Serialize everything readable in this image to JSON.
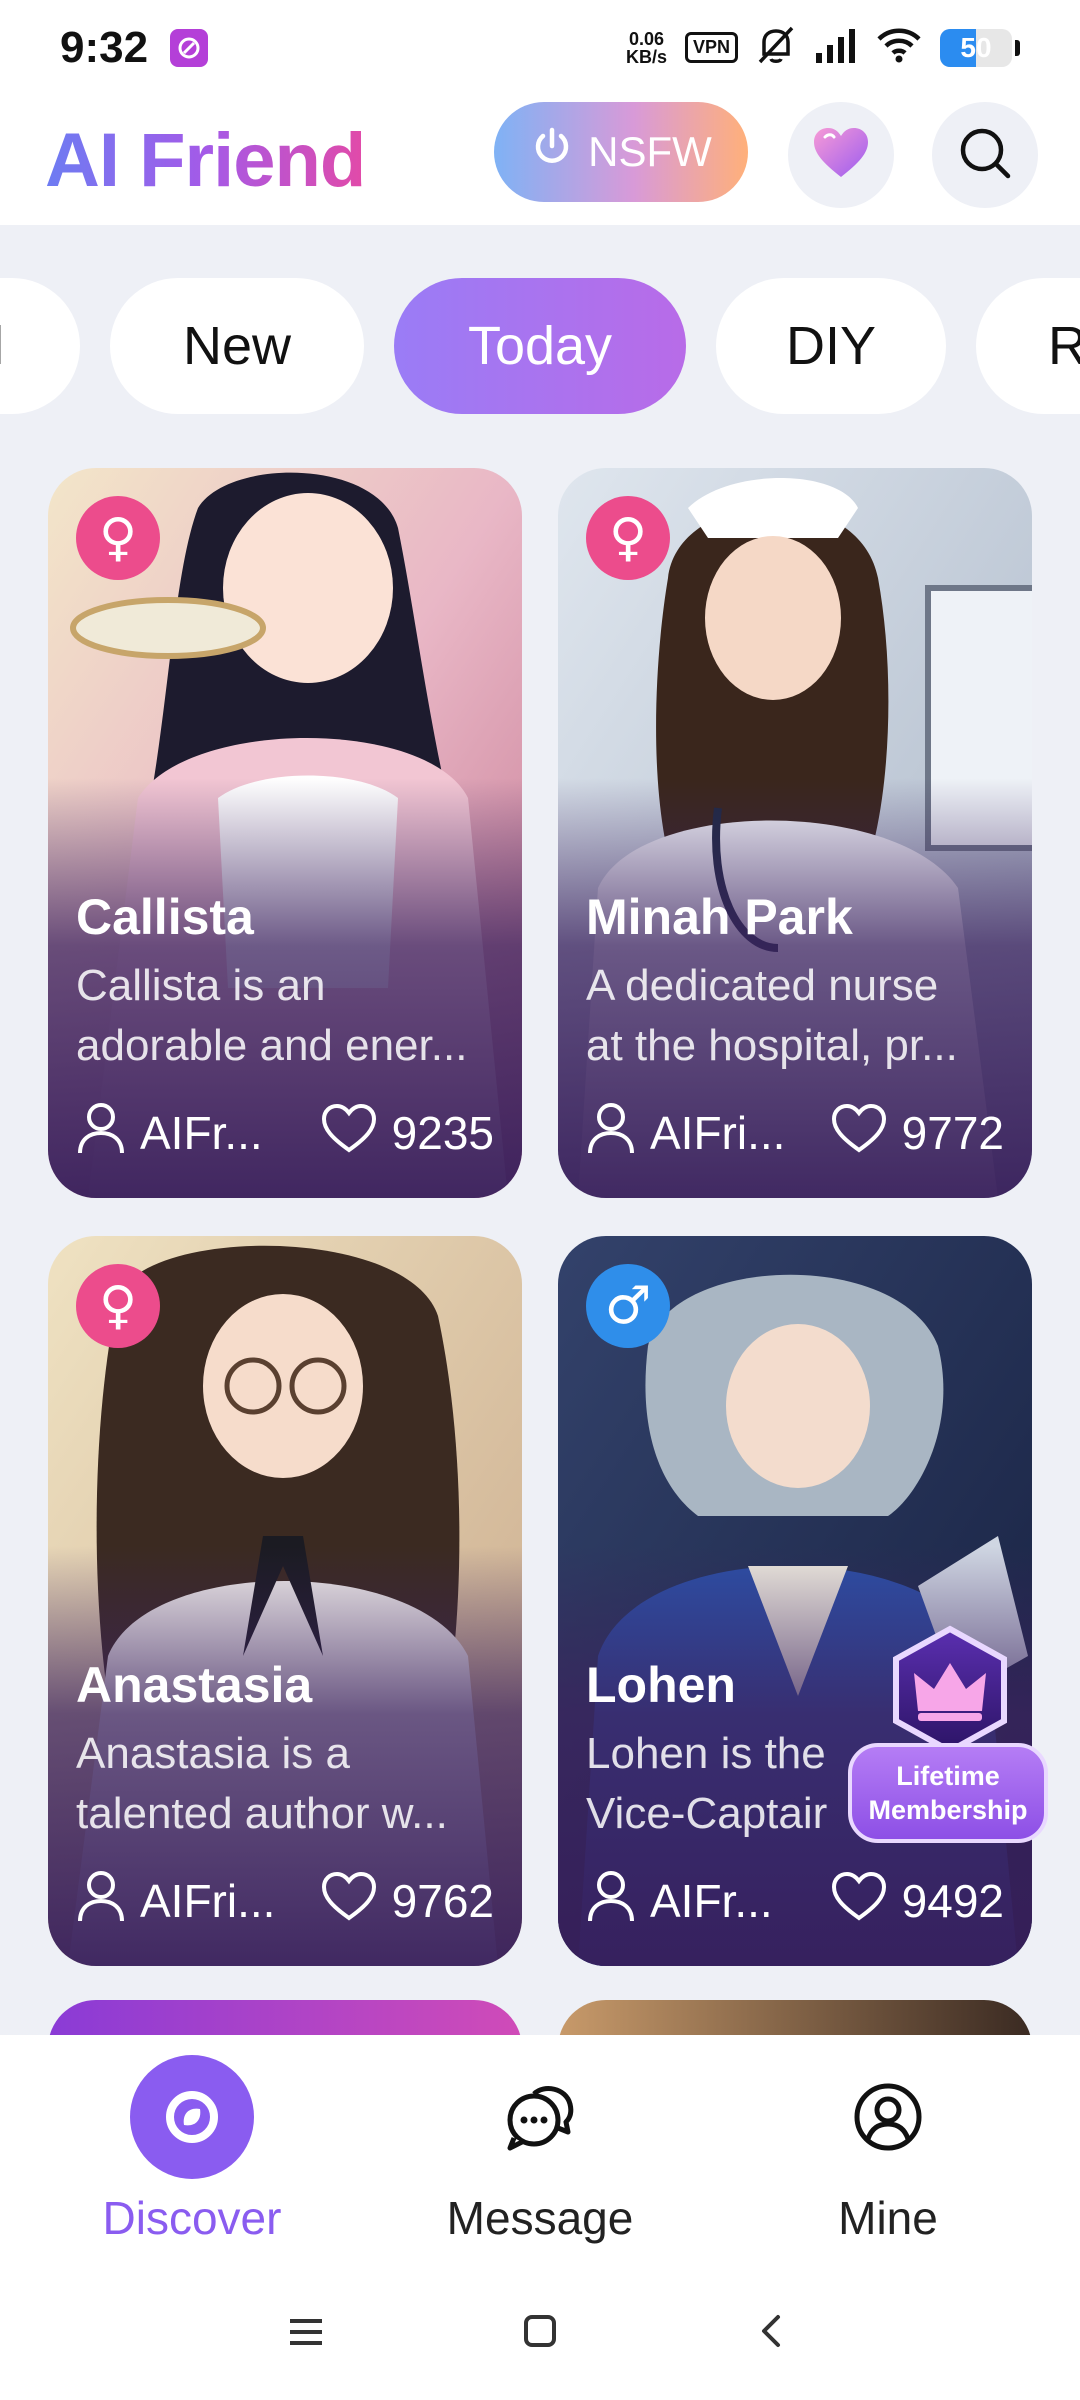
{
  "status_bar": {
    "time": "9:32",
    "net_speed_top": "0.06",
    "net_speed_bottom": "KB/s",
    "vpn": "VPN",
    "battery": "50",
    "battery_level": 0.5
  },
  "header": {
    "title": "AI Friend",
    "nsfw_label": "NSFW"
  },
  "tabs": [
    {
      "label": "l",
      "active": false
    },
    {
      "label": "New",
      "active": false
    },
    {
      "label": "Today",
      "active": true
    },
    {
      "label": "DIY",
      "active": false
    },
    {
      "label": "R",
      "active": false
    }
  ],
  "cards": [
    {
      "name": "Callista",
      "gender": "female",
      "gender_symbol": "♀",
      "desc": "Callista is an\nadorable and ener...",
      "author": "AIFr...",
      "likes": "9235"
    },
    {
      "name": "Minah Park",
      "gender": "female",
      "gender_symbol": "♀",
      "desc": "A dedicated nurse\nat the hospital, pr...",
      "author": "AIFri...",
      "likes": "9772"
    },
    {
      "name": "Anastasia",
      "gender": "female",
      "gender_symbol": "♀",
      "desc": "Anastasia is a\ntalented author w...",
      "author": "AIFri...",
      "likes": "9762"
    },
    {
      "name": "Lohen",
      "gender": "male",
      "gender_symbol": "♂",
      "desc": "Lohen is the\nVice-Captair",
      "author": "AIFr...",
      "likes": "9492"
    }
  ],
  "membership": {
    "line1": "Lifetime",
    "line2": "Membership"
  },
  "bottom_nav": {
    "discover": "Discover",
    "message": "Message",
    "mine": "Mine"
  },
  "colors": {
    "accent": "#8a5cf0",
    "female_badge": "#ec4c8c",
    "male_badge": "#2f8eea"
  }
}
